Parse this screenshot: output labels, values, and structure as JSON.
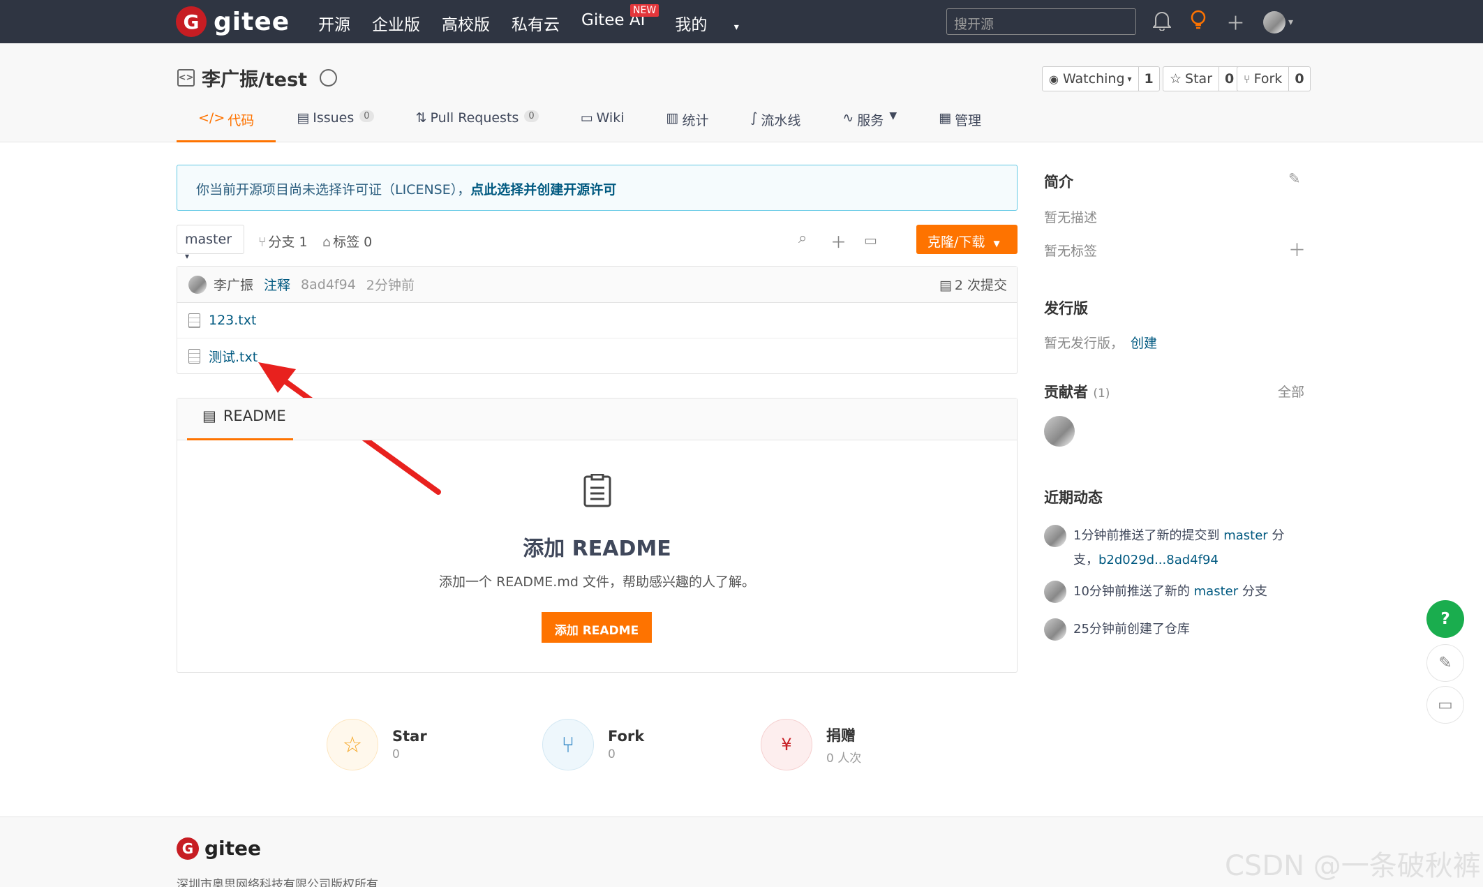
{
  "topbar": {
    "brand": "gitee",
    "logo_letter": "G",
    "nav": [
      "开源",
      "企业版",
      "高校版",
      "私有云",
      "Gitee AI",
      "我的"
    ],
    "new_badge": "NEW",
    "search_placeholder": "搜开源"
  },
  "repo": {
    "title": "李广振/test",
    "watching_label": "Watching",
    "watching_count": "1",
    "star_label": "Star",
    "star_count": "0",
    "fork_label": "Fork",
    "fork_count": "0"
  },
  "tabs": [
    {
      "label": "代码"
    },
    {
      "label": "Issues",
      "count": "0"
    },
    {
      "label": "Pull Requests",
      "count": "0"
    },
    {
      "label": "Wiki"
    },
    {
      "label": "统计"
    },
    {
      "label": "流水线"
    },
    {
      "label": "服务"
    },
    {
      "label": "管理"
    }
  ],
  "notice": {
    "text": "你当前开源项目尚未选择许可证（LICENSE），",
    "link": "点此选择并创建开源许可"
  },
  "branch": {
    "name": "master",
    "branches": "分支 1",
    "tags": "标签 0",
    "clone": "克隆/下载"
  },
  "commit": {
    "author": "李广振",
    "message": "注释",
    "hash": "8ad4f94",
    "time": "2分钟前",
    "count": "2 次提交"
  },
  "files": [
    "123.txt",
    "测试.txt"
  ],
  "readme": {
    "tab": "README",
    "title": "添加 README",
    "desc": "添加一个 README.md 文件，帮助感兴趣的人了解。",
    "button": "添加 README"
  },
  "stats": [
    {
      "name": "Star",
      "value": "0"
    },
    {
      "name": "Fork",
      "value": "0"
    },
    {
      "name": "捐赠",
      "value": "0 人次"
    }
  ],
  "sidebar": {
    "intro_title": "简介",
    "no_desc": "暂无描述",
    "no_tags": "暂无标签",
    "release_title": "发行版",
    "no_release": "暂无发行版，",
    "create": "创建",
    "contributors_title": "贡献者",
    "contributors_count": "(1)",
    "all": "全部",
    "activity_title": "近期动态",
    "activities": [
      {
        "pre": "1分钟前推送了新的提交到 ",
        "branch": "master",
        "post": " 分",
        "line2_pre": "支，",
        "range": "b2d029d...8ad4f94"
      },
      {
        "pre": "10分钟前推送了新的 ",
        "branch": "master",
        "post": " 分支"
      },
      {
        "pre": "25分钟前创建了仓库"
      }
    ]
  },
  "footer": {
    "brand": "gitee",
    "copyright": "深圳市奥思网络科技有限公司版权所有"
  },
  "watermark": "CSDN @一条破秋裤",
  "colors": {
    "accent": "#fe7300",
    "topbar": "#2f3542",
    "link": "#005980",
    "arrow": "#e8211e"
  }
}
